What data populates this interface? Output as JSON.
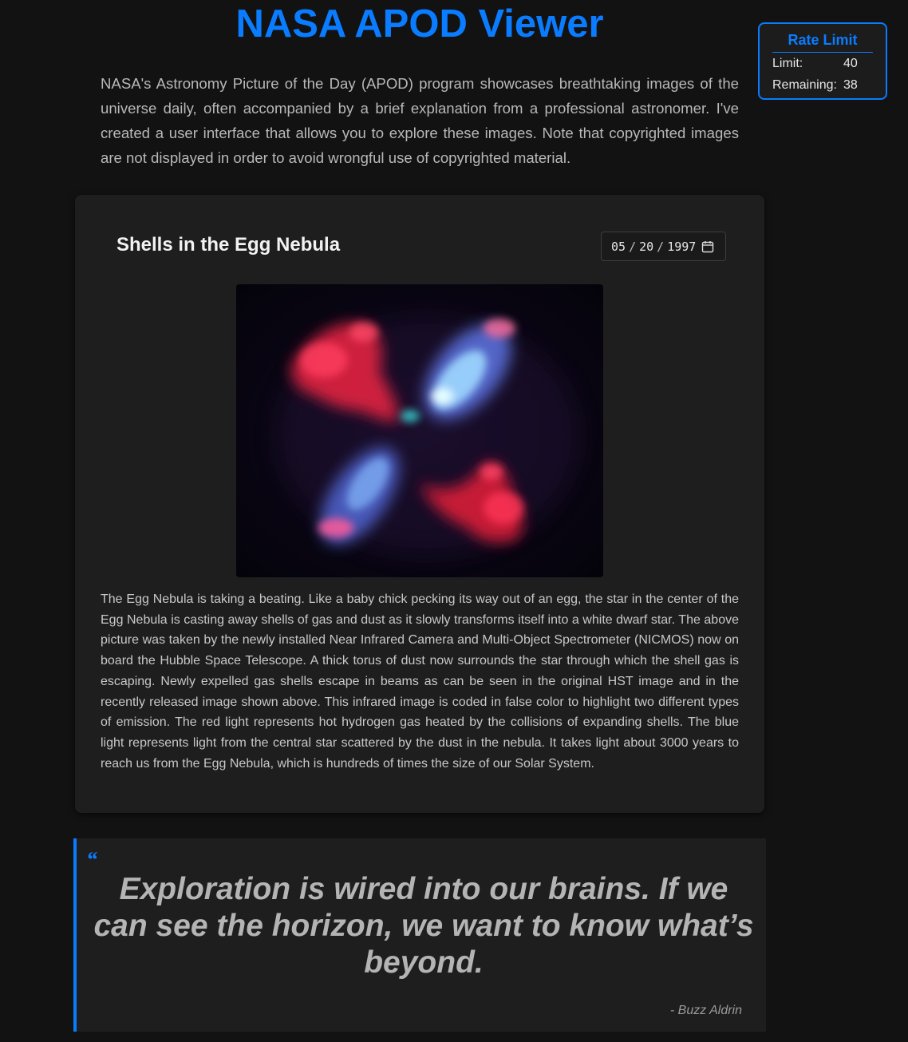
{
  "header": {
    "title": "NASA APOD Viewer",
    "intro": "NASA's Astronomy Picture of the Day (APOD) program showcases breathtaking images of the universe daily, often accompanied by a brief explanation from a professional astronomer. I've created a user interface that allows you to explore these images. Note that copyrighted images are not displayed in order to avoid wrongful use of copyrighted material."
  },
  "rate_limit": {
    "title": "Rate Limit",
    "limit_label": "Limit:",
    "limit_value": "40",
    "remaining_label": "Remaining:",
    "remaining_value": "38"
  },
  "apod": {
    "title": "Shells in the Egg Nebula",
    "date": {
      "month": "05",
      "day": "20",
      "year": "1997"
    },
    "image_icon": "egg-nebula-image",
    "explanation": "The Egg Nebula is taking a beating. Like a baby chick pecking its way out of an egg, the star in the center of the Egg Nebula is casting away shells of gas and dust as it slowly transforms itself into a white dwarf star. The above picture was taken by the newly installed Near Infrared Camera and Multi-Object Spectrometer (NICMOS) now on board the Hubble Space Telescope. A thick torus of dust now surrounds the star through which the shell gas is escaping. Newly expelled gas shells escape in beams as can be seen in the original HST image and in the recently released image shown above. This infrared image is coded in false color to highlight two different types of emission. The red light represents hot hydrogen gas heated by the collisions of expanding shells. The blue light represents light from the central star scattered by the dust in the nebula. It takes light about 3000 years to reach us from the Egg Nebula, which is hundreds of times the size of our Solar System."
  },
  "quote": {
    "mark": "“",
    "text": "Exploration is wired into our brains. If we can see the horizon, we want to know what’s beyond.",
    "author": "- Buzz Aldrin"
  },
  "colors": {
    "accent": "#0a7cff",
    "background": "#121212",
    "card": "#1e1e1e"
  }
}
